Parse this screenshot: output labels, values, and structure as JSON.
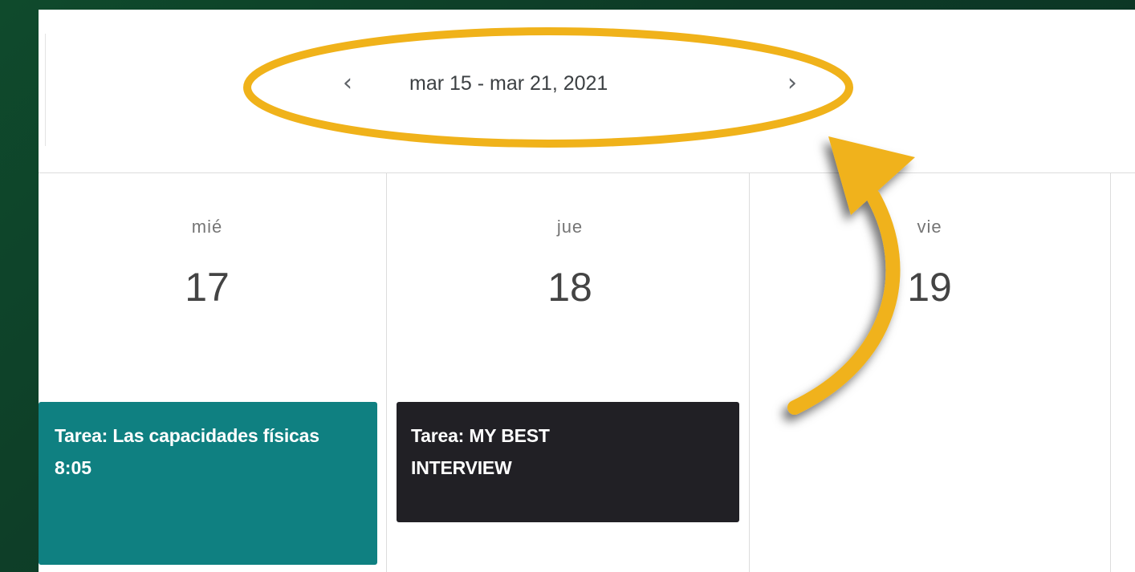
{
  "toolbar": {
    "prev_icon": "‹",
    "next_icon": "›",
    "week_range": "mar 15 - mar 21, 2021"
  },
  "days": [
    {
      "name": "mié",
      "number": "17"
    },
    {
      "name": "jue",
      "number": "18"
    },
    {
      "name": "vie",
      "number": "19"
    }
  ],
  "events": [
    {
      "title": "Tarea: Las capacidades físicas",
      "time": "8:05",
      "color": "#0f8081"
    },
    {
      "title": "Tarea: MY BEST INTERVIEW",
      "color": "#212025"
    }
  ],
  "annotation": {
    "highlight_color": "#f0b21a",
    "icons": [
      "ellipse-highlight",
      "curved-arrow-icon"
    ]
  }
}
